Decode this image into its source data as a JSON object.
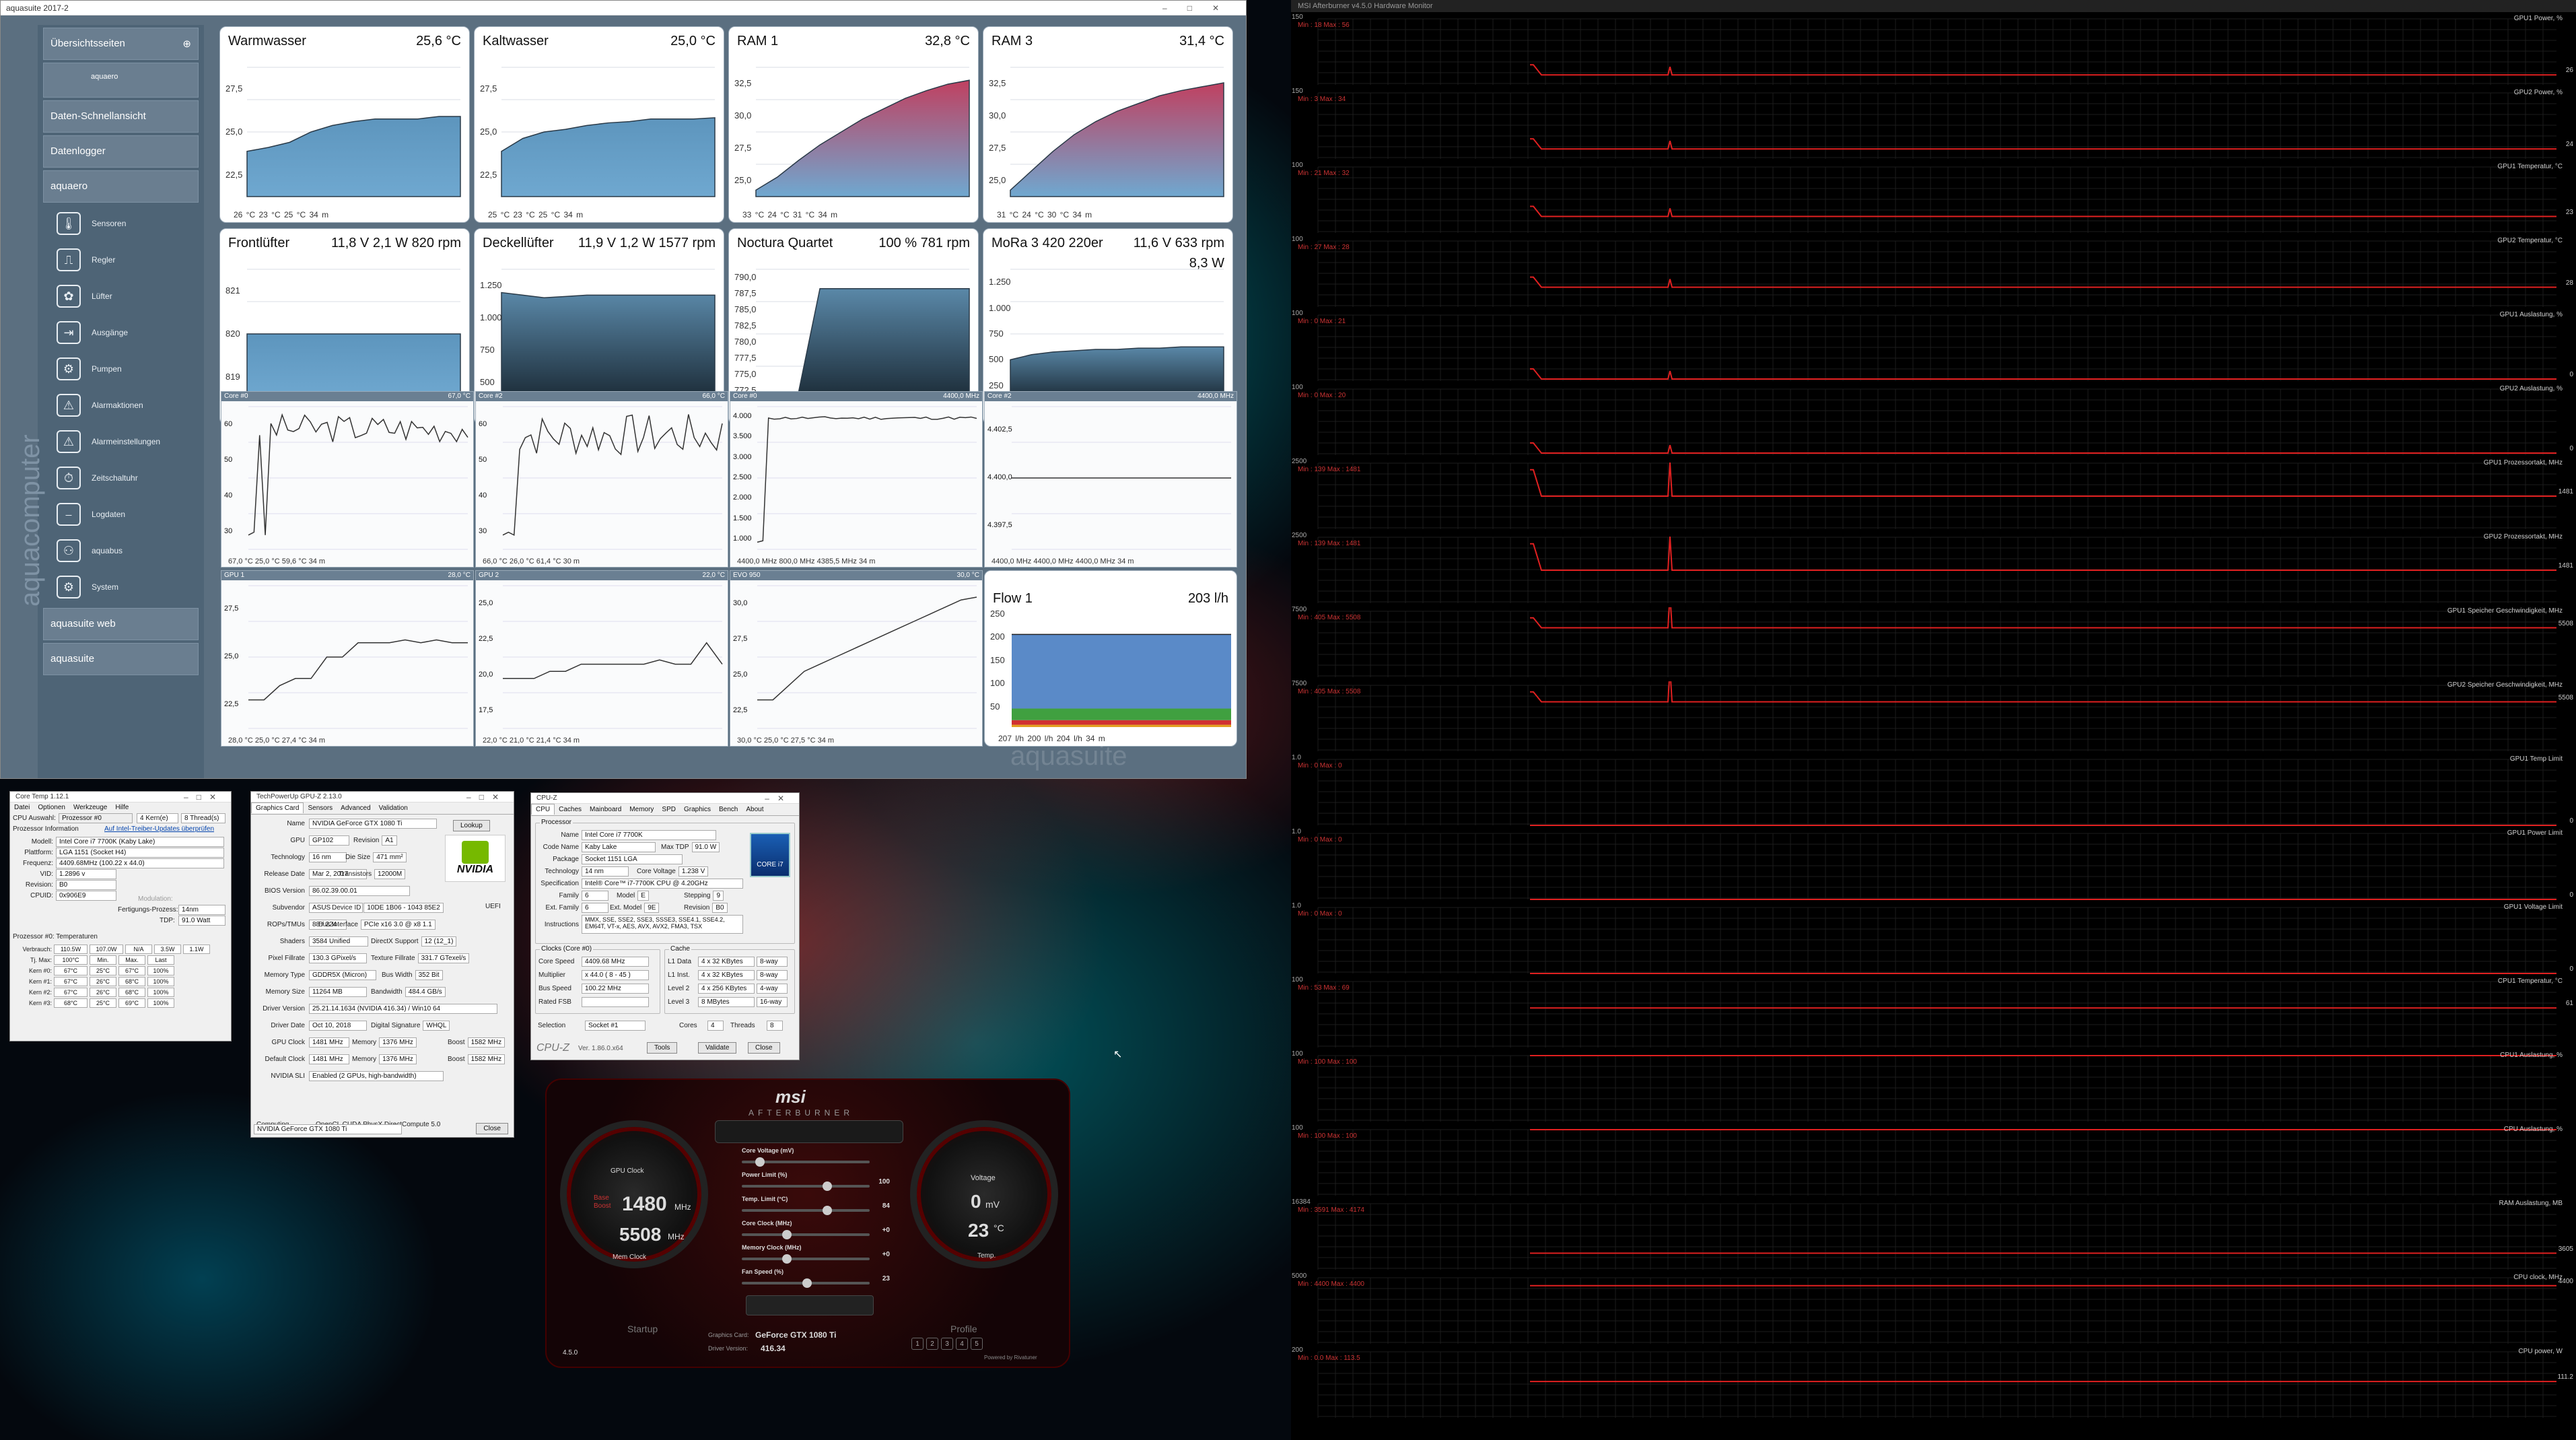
{
  "aquasuite": {
    "title": "aquasuite 2017-2",
    "side": {
      "overview": "Übersichtsseiten",
      "item_aquaero": "aquaero",
      "quickview": "Daten-Schnellansicht",
      "datalogger": "Datenlogger",
      "device": "aquaero",
      "subitems": [
        "Sensoren",
        "Regler",
        "Lüfter",
        "Ausgänge",
        "Pumpen",
        "Alarmaktionen",
        "Alarmeinstellungen",
        "Zeitschaltuhr",
        "Logdaten",
        "aquabus",
        "System"
      ],
      "web": "aquasuite web",
      "suite": "aquasuite",
      "brand": "aquacomputer"
    },
    "tiles": [
      {
        "name": "Warmwasser",
        "value": "25,6 °C",
        "yticks": [
          "27,5",
          "25,0",
          "22,5"
        ],
        "foot": "26 °C   23 °C   25 °C        34 m"
      },
      {
        "name": "Kaltwasser",
        "value": "25,0 °C",
        "yticks": [
          "27,5",
          "25,0",
          "22,5"
        ],
        "foot": "25 °C   23 °C   25 °C        34 m"
      },
      {
        "name": "RAM 1",
        "value": "32,8 °C",
        "yticks": [
          "32,5",
          "30,0",
          "27,5",
          "25,0"
        ],
        "foot": "33 °C   24 °C   31 °C        34 m"
      },
      {
        "name": "RAM 3",
        "value": "31,4 °C",
        "yticks": [
          "32,5",
          "30,0",
          "27,5",
          "25,0"
        ],
        "foot": "31 °C   24 °C   30 °C        34 m"
      },
      {
        "name": "Frontlüfter",
        "value": "11,8 V   2,1 W    820 rpm",
        "yticks": [
          "821",
          "820",
          "819"
        ],
        "foot": "820 rpm   820 rpm   820 rpm      34 m"
      },
      {
        "name": "Deckellüfter",
        "value": "11,9 V   1,2 W 1577 rpm",
        "yticks": [
          "1.250",
          "1.000",
          "750",
          "500"
        ],
        "foot": "1577 rpm  1543 rpm  1571 rpm   34 m"
      },
      {
        "name": "Noctura Quartet",
        "value": "100 %    781 rpm",
        "yticks": [
          "790,0",
          "787,5",
          "785,0",
          "782,5",
          "780,0",
          "777,5",
          "775,0",
          "772,5"
        ],
        "foot": "781 rpm   770 rpm   778 rpm    34 m"
      },
      {
        "name": "MoRa 3 420 220er",
        "value": "11,6 V    633 rpm",
        "sub": "8,3 W",
        "yticks": [
          "1.250",
          "1.000",
          "750",
          "500",
          "250"
        ],
        "foot": "633 rpm   545 rpm   598 rpm    34 m"
      }
    ],
    "graphs_row1": [
      {
        "head": "Core #0",
        "right": "67,0 °C",
        "yticks": [
          "60",
          "50",
          "40",
          "30"
        ],
        "foot": "67,0 °C    25,0 °C    59,6 °C       34 m"
      },
      {
        "head": "Core #2",
        "right": "66,0 °C",
        "yticks": [
          "60",
          "50",
          "40",
          "30"
        ],
        "foot": "66,0 °C    26,0 °C    61,4 °C       30 m"
      },
      {
        "head": "Core #0",
        "right": "4400,0 MHz",
        "yticks": [
          "4.000",
          "3.500",
          "3.000",
          "2.500",
          "2.000",
          "1.500",
          "1.000"
        ],
        "foot": "4400,0 MHz  800,0 MHz  4385,5 MHz   34 m"
      },
      {
        "head": "Core #2",
        "right": "4400,0 MHz",
        "yticks": [
          "4.402,5",
          "4.400,0",
          "4.397,5"
        ],
        "foot": "4400,0 MHz  4400,0 MHz  4400,0 MHz   34 m"
      }
    ],
    "graphs_row2": [
      {
        "head": "GPU 1",
        "right": "28,0 °C",
        "yticks": [
          "27,5",
          "25,0",
          "22,5"
        ],
        "foot": "28,0 °C    25,0 °C    27,4 °C       34 m"
      },
      {
        "head": "GPU 2",
        "right": "22,0 °C",
        "yticks": [
          "25,0",
          "22,5",
          "20,0",
          "17,5"
        ],
        "foot": "22,0 °C    21,0 °C    21,4 °C       34 m"
      },
      {
        "head": "EVO 950",
        "right": "30,0 °C",
        "yticks": [
          "30,0",
          "27,5",
          "25,0",
          "22,5"
        ],
        "foot": "30,0 °C    25,0 °C    27,5 °C       34 m"
      }
    ],
    "flow": {
      "name": "Flow 1",
      "value": "203 l/h",
      "yticks": [
        "250",
        "200",
        "150",
        "100",
        "50"
      ],
      "foot": "207 l/h   200 l/h   204 l/h    34 m"
    },
    "watermark": "aquasuite"
  },
  "coretemp": {
    "title": "Core Temp 1.12.1",
    "menu": [
      "Datei",
      "Optionen",
      "Werkzeuge",
      "Hilfe"
    ],
    "select_label": "CPU Auswahl:",
    "select_val": "Prozessor #0",
    "kerne": "4  Kern(e)",
    "threads": "8  Thread(s)",
    "info_label": "Prozessor Information",
    "info_link": "Auf Intel-Treiber-Updates überprüfen",
    "rows": [
      [
        "Modell:",
        "Intel Core i7 7700K (Kaby Lake)"
      ],
      [
        "Plattform:",
        "LGA 1151 (Socket H4)"
      ],
      [
        "Frequenz:",
        "4409.68MHz (100.22 x 44.0)"
      ],
      [
        "VID:",
        "1.2896 v"
      ],
      [
        "Revision:",
        "B0"
      ],
      [
        "CPUID:",
        "0x906E9"
      ]
    ],
    "modul": "Modulation:",
    "litho_label": "Fertigungs-Prozess:",
    "litho": "14nm",
    "tdp_label": "TDP:",
    "tdp": "91.0 Watt",
    "temps_head": "Prozessor #0: Temperaturen",
    "power": [
      "Verbrauch:",
      "110.5W",
      "107.0W",
      "N/A",
      "3.5W",
      "1.1W"
    ],
    "tj": [
      "Tj. Max:",
      "100°C",
      "Min.",
      "Max.",
      "Last"
    ],
    "cores": [
      [
        "Kern #0:",
        "67°C",
        "25°C",
        "67°C",
        "100%"
      ],
      [
        "Kern #1:",
        "67°C",
        "26°C",
        "68°C",
        "100%"
      ],
      [
        "Kern #2:",
        "67°C",
        "26°C",
        "68°C",
        "100%"
      ],
      [
        "Kern #3:",
        "68°C",
        "25°C",
        "69°C",
        "100%"
      ]
    ]
  },
  "gpuz": {
    "title": "TechPowerUp GPU-Z 2.13.0",
    "tabs": [
      "Graphics Card",
      "Sensors",
      "Advanced",
      "Validation"
    ],
    "rows": [
      [
        "Name",
        "NVIDIA GeForce GTX 1080 Ti"
      ],
      [
        "GPU",
        "GP102"
      ],
      [
        "Technology",
        "16 nm"
      ],
      [
        "Release Date",
        "Mar 2, 2017"
      ],
      [
        "BIOS Version",
        "86.02.39.00.01"
      ],
      [
        "Subvendor",
        "ASUS"
      ],
      [
        "ROPs/TMUs",
        "88 / 224"
      ],
      [
        "Shaders",
        "3584 Unified"
      ],
      [
        "Pixel Fillrate",
        "130.3 GPixel/s"
      ],
      [
        "Memory Type",
        "GDDR5X (Micron)"
      ],
      [
        "Memory Size",
        "11264 MB"
      ],
      [
        "Driver Version",
        "25.21.14.1634 (NVIDIA 416.34) / Win10 64"
      ],
      [
        "Driver Date",
        "Oct 10, 2018"
      ],
      [
        "GPU Clock",
        "1481 MHz"
      ],
      [
        "Default Clock",
        "1481 MHz"
      ],
      [
        "NVIDIA SLI",
        "Enabled (2 GPUs, high-bandwidth)"
      ]
    ],
    "extra": {
      "lookup": "Lookup",
      "revision": "Revision",
      "rev_val": "A1",
      "die": "Die Size",
      "die_val": "471 mm²",
      "trans": "Transistors",
      "trans_val": "12000M",
      "uefi": "UEFI",
      "devid": "Device ID",
      "devid_val": "10DE 1B06 - 1043 85E2",
      "bus": "Bus Interface",
      "bus_val": "PCIe x16 3.0 @ x8 1.1",
      "dx": "DirectX Support",
      "dx_val": "12 (12_1)",
      "tex": "Texture Fillrate",
      "tex_val": "331.7 GTexel/s",
      "bw": "Bus Width",
      "bw_val": "352 Bit",
      "bandw": "Bandwidth",
      "bandw_val": "484.4 GB/s",
      "sig": "Digital Signature",
      "sig_val": "WHQL",
      "mem": "Memory",
      "mem_val": "1376 MHz",
      "boost": "Boost",
      "boost_val": "1582 MHz",
      "mem2_val": "1376 MHz",
      "boost2_val": "1582 MHz"
    },
    "computing_label": "Computing",
    "computing": "OpenCL   CUDA   PhysX   DirectCompute 5.0",
    "select": "NVIDIA GeForce GTX 1080 Ti",
    "close": "Close",
    "brand": "NVIDIA"
  },
  "cpuz": {
    "title": "CPU-Z",
    "tabs": [
      "CPU",
      "Caches",
      "Mainboard",
      "Memory",
      "SPD",
      "Graphics",
      "Bench",
      "About"
    ],
    "proc_label": "Processor",
    "rows": [
      [
        "Name",
        "Intel Core i7 7700K"
      ],
      [
        "Code Name",
        "Kaby Lake"
      ],
      [
        "Package",
        "Socket 1151 LGA"
      ],
      [
        "Technology",
        "14 nm"
      ],
      [
        "Specification",
        "Intel® Core™ i7-7700K CPU @ 4.20GHz"
      ],
      [
        "Family",
        "6"
      ],
      [
        "Ext. Family",
        "6"
      ],
      [
        "Instructions",
        "MMX, SSE, SSE2, SSE3, SSSE3, SSE4.1, SSE4.2, EM64T, VT-x, AES, AVX, AVX2, FMA3, TSX"
      ]
    ],
    "maxtdp": "Max TDP",
    "maxtdp_val": "91.0 W",
    "corev": "Core Voltage",
    "corev_val": "1.238 V",
    "model": "Model",
    "model_val": "E",
    "stepping": "Stepping",
    "stepping_val": "9",
    "extmodel": "Ext. Model",
    "extmodel_val": "9E",
    "revision": "Revision",
    "revision_val": "B0",
    "clocks_label": "Clocks (Core #0)",
    "clocks": [
      [
        "Core Speed",
        "4409.68 MHz"
      ],
      [
        "Multiplier",
        "x 44.0 ( 8 - 45 )"
      ],
      [
        "Bus Speed",
        "100.22 MHz"
      ],
      [
        "Rated FSB",
        ""
      ]
    ],
    "cache_label": "Cache",
    "cache": [
      [
        "L1 Data",
        "4 x 32 KBytes",
        "8-way"
      ],
      [
        "L1 Inst.",
        "4 x 32 KBytes",
        "8-way"
      ],
      [
        "Level 2",
        "4 x 256 KBytes",
        "4-way"
      ],
      [
        "Level 3",
        "8 MBytes",
        "16-way"
      ]
    ],
    "selection": "Selection",
    "socket": "Socket #1",
    "cores_label": "Cores",
    "cores": "4",
    "threads_label": "Threads",
    "threads": "8",
    "ver": "Ver. 1.86.0.x64",
    "tools": "Tools",
    "validate": "Validate",
    "close": "Close",
    "logo": "CPU-Z",
    "badge": "CORE i7"
  },
  "afterburner": {
    "brand": "msi",
    "sub": "AFTERBURNER",
    "gpu_clock_label": "GPU Clock",
    "base": "Base",
    "boost": "Boost",
    "gpu_mhz": "1480",
    "mhz": "MHz",
    "mem_mhz": "5508",
    "mem_label": "Mem Clock",
    "voltage_label": "Voltage",
    "mv": "0",
    "mv_unit": "mV",
    "temp": "23",
    "temp_unit": "°C",
    "temp_label": "Temp.",
    "sliders": [
      [
        "Core Voltage (mV)",
        ""
      ],
      [
        "Power Limit (%)",
        "100"
      ],
      [
        "Temp. Limit (°C)",
        "84"
      ],
      [
        "Core Clock (MHz)",
        "+0"
      ],
      [
        "Memory Clock (MHz)",
        "+0"
      ],
      [
        "Fan Speed (%)",
        "23"
      ]
    ],
    "startup": "Startup",
    "profile": "Profile",
    "card_label": "Graphics Card:",
    "card": "GeForce GTX 1080 Ti",
    "driver_label": "Driver Version:",
    "driver": "416.34",
    "version": "4.5.0",
    "powered": "Powered by Rivatuner",
    "profiles": [
      "1",
      "2",
      "3",
      "4",
      "5"
    ]
  },
  "monitor": {
    "title": "MSI Afterburner v4.5.0 Hardware Monitor",
    "rows": [
      {
        "name": "GPU1 Power, %",
        "top": "150",
        "mm": "Min : 18   Max : 56",
        "cur": "26"
      },
      {
        "name": "GPU2 Power, %",
        "top": "150",
        "mm": "Min : 3   Max : 34",
        "cur": "24"
      },
      {
        "name": "GPU1 Temperatur, °C",
        "top": "100",
        "mm": "Min : 21   Max : 32",
        "cur": "23"
      },
      {
        "name": "GPU2 Temperatur, °C",
        "top": "100",
        "mm": "Min : 27   Max : 28",
        "cur": "28"
      },
      {
        "name": "GPU1 Auslastung, %",
        "top": "100",
        "mm": "Min : 0   Max : 21",
        "cur": "0"
      },
      {
        "name": "GPU2 Auslastung, %",
        "top": "100",
        "mm": "Min : 0   Max : 20",
        "cur": "0"
      },
      {
        "name": "GPU1 Prozessortakt, MHz",
        "top": "2500",
        "mm": "Min : 139   Max : 1481",
        "cur": "1481"
      },
      {
        "name": "GPU2 Prozessortakt, MHz",
        "top": "2500",
        "mm": "Min : 139   Max : 1481",
        "cur": "1481"
      },
      {
        "name": "GPU1 Speicher Geschwindigkeit, MHz",
        "top": "7500",
        "mm": "Min : 405   Max : 5508",
        "cur": "5508"
      },
      {
        "name": "GPU2 Speicher Geschwindigkeit, MHz",
        "top": "7500",
        "mm": "Min : 405   Max : 5508",
        "cur": "5508"
      },
      {
        "name": "GPU1 Temp Limit",
        "top": "1.0",
        "mm": "Min : 0   Max : 0",
        "cur": "0"
      },
      {
        "name": "GPU1 Power Limit",
        "top": "1.0",
        "mm": "Min : 0   Max : 0",
        "cur": "0"
      },
      {
        "name": "GPU1 Voltage Limit",
        "top": "1.0",
        "mm": "Min : 0   Max : 0",
        "cur": "0"
      },
      {
        "name": "CPU1 Temperatur, °C",
        "top": "100",
        "mm": "Min : 53   Max : 69",
        "cur": "61"
      },
      {
        "name": "CPU1 Auslastung, %",
        "top": "100",
        "mm": "Min : 100   Max : 100",
        "cur": ""
      },
      {
        "name": "CPU Auslastung, %",
        "top": "100",
        "mm": "Min : 100   Max : 100",
        "cur": ""
      },
      {
        "name": "RAM Auslastung, MB",
        "top": "16384",
        "mm": "Min : 3591   Max : 4174",
        "cur": "3605"
      },
      {
        "name": "CPU clock, MHz",
        "top": "5000",
        "mm": "Min : 4400   Max : 4400",
        "cur": "4400"
      },
      {
        "name": "CPU power, W",
        "top": "200",
        "mm": "Min : 0.0   Max : 113.5",
        "cur": "111.2"
      }
    ]
  }
}
